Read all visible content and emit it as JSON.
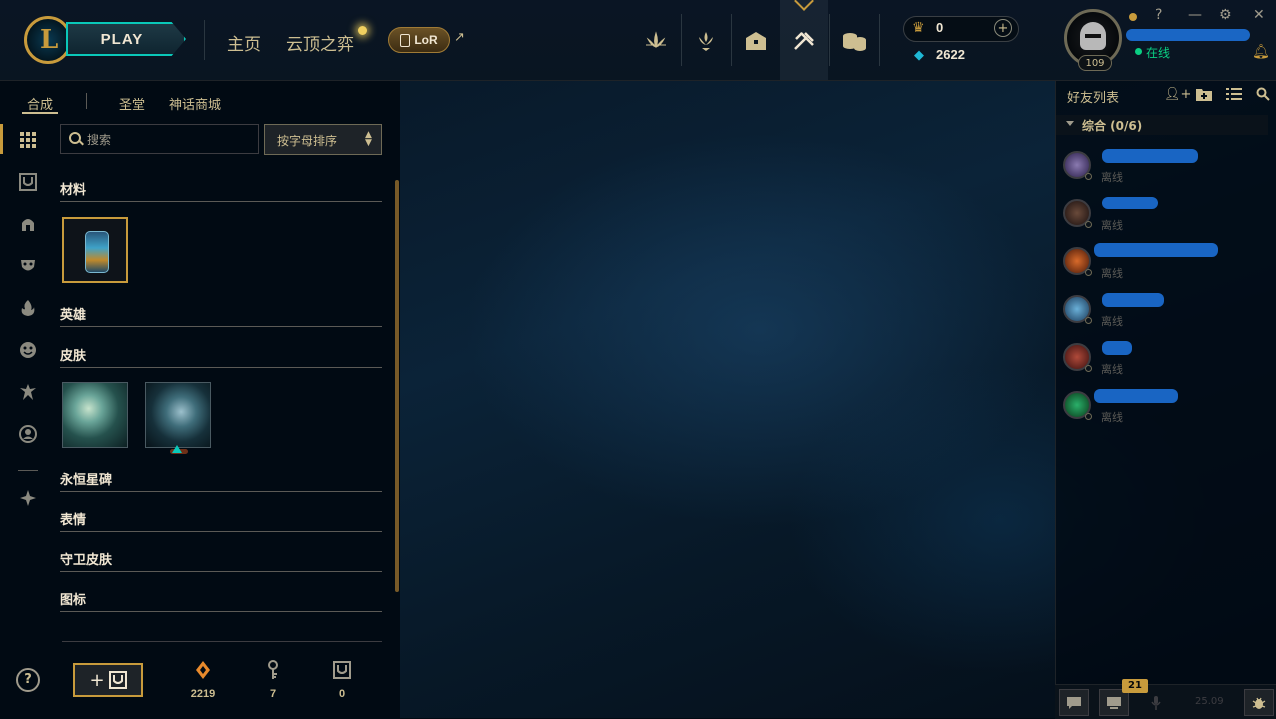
{
  "header": {
    "play_label": "PLAY",
    "nav": [
      "主页",
      "云顶之弈"
    ],
    "lor_label": "LoR",
    "lor_arrow": "↗",
    "rp_value": "0",
    "be_value": "2622",
    "level": "109",
    "status": "在线",
    "window_controls": [
      "?",
      "—",
      "⚙",
      "✕"
    ]
  },
  "left": {
    "sub_tabs": [
      "合成",
      "圣堂",
      "神话商城"
    ],
    "search_placeholder": "搜索",
    "sort_label": "按字母排序",
    "categories": [
      "材料",
      "英雄",
      "皮肤",
      "永恒星碑",
      "表情",
      "守卫皮肤",
      "图标"
    ],
    "help_label": "?",
    "add_label": "+",
    "currencies": [
      {
        "name": "orange-essence",
        "value": "2219"
      },
      {
        "name": "keys",
        "value": "7"
      },
      {
        "name": "chests",
        "value": "0"
      }
    ]
  },
  "friends": {
    "title": "好友列表",
    "group_label": "综合 (0/6)",
    "items": [
      {
        "status": "离线",
        "color": "#5a4a7a"
      },
      {
        "status": "离线",
        "color": "#3a2a2a"
      },
      {
        "status": "离线",
        "color": "#8a3a1a"
      },
      {
        "status": "离线",
        "color": "#2a6a8a"
      },
      {
        "status": "离线",
        "color": "#7a2a2a"
      },
      {
        "status": "离线",
        "color": "#1a6a3a"
      }
    ],
    "badge_count": "21",
    "version": "25.09"
  },
  "colors": {
    "gold": "#c89b3c",
    "teal": "#0ac8b9",
    "online": "#0acf83",
    "bg": "#010a13"
  }
}
